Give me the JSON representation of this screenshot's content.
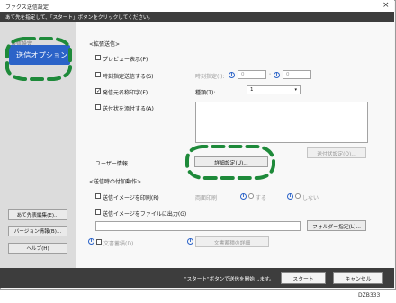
{
  "window": {
    "title": "ファクス送信設定",
    "close": "×"
  },
  "instruction": "あて先を指定して、「スタート」ボタンをクリックしてください。",
  "sidebar": {
    "hidden_item": "送信設定",
    "selected_item": "送信オプション",
    "buttons": [
      "あて先表編集(E)...",
      "バージョン情報(B)...",
      "ヘルプ(H)"
    ]
  },
  "extended": {
    "section_title": "<拡張送信>",
    "preview": "プレビュー表示(P)",
    "timer": "時刻指定送信する(S)",
    "timer_label": "時刻指定(I):",
    "timer_hour": "0",
    "timer_colon": ":",
    "timer_min": "0",
    "sender": "発信元名称印字(F)",
    "type_label": "種類(T):",
    "type_value": "1",
    "coversheet": "送付状を添付する(A)",
    "coversheet_btn": "送付状設定(O)...",
    "user_info": "ユーザー情報",
    "detail_btn": "詳細設定(U)..."
  },
  "after": {
    "section_title": "<送信時の付加動作>",
    "print_image": "送信イメージを印刷(R)",
    "duplex_label": "両面印刷",
    "on": "する",
    "off": "しない",
    "save_image": "送信イメージをファイルに出力(G)",
    "folder_btn": "フォルダー指定(L)...",
    "doc_store": "文書蓄積(D)",
    "doc_info_btn": "文書蓄積の詳細"
  },
  "footer": {
    "message": "\"スタート\"ボタンで送信を開始します。",
    "start": "スタート",
    "cancel": "キャンセル"
  },
  "code": "DZB333",
  "colors": {
    "accent": "#2b63c8",
    "highlight_dashes": "#1e8a3a",
    "bar": "#3d3d3d"
  }
}
